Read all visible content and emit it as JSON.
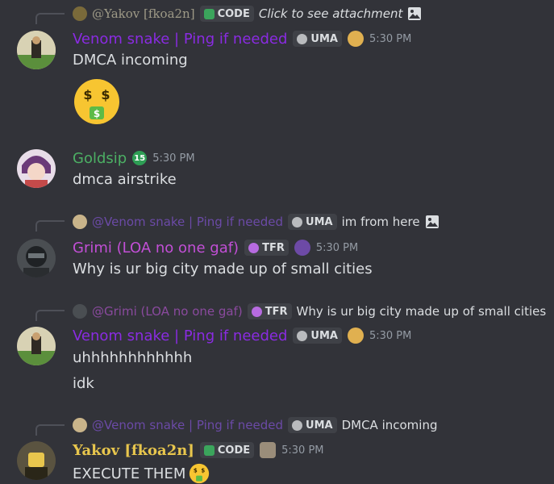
{
  "messages": [
    {
      "reply": {
        "name": "@Yakov [fkoa2n]",
        "tag": "CODE",
        "text": "Click to see attachment",
        "icon": "image-icon"
      },
      "author": "Venom snake | Ping if needed",
      "tag": "UMA",
      "time": "5:30 PM",
      "lines": [
        "DMCA incoming"
      ],
      "emoji": "money-mouth-face-emoji"
    },
    {
      "author": "Goldsip",
      "badge": "15",
      "time": "5:30 PM",
      "lines": [
        "dmca airstrike"
      ]
    },
    {
      "reply": {
        "name": "@Venom snake | Ping if needed",
        "tag": "UMA",
        "text": "im from here",
        "icon": "image-icon"
      },
      "author": "Grimi (LOA no one gaf)",
      "tag": "TFR",
      "time": "5:30 PM",
      "lines": [
        "Why is ur big city made up of small cities"
      ]
    },
    {
      "reply": {
        "name": "@Grimi (LOA no one gaf)",
        "tag": "TFR",
        "text": "Why is ur big city made up of small cities"
      },
      "author": "Venom snake | Ping if needed",
      "tag": "UMA",
      "time": "5:30 PM",
      "lines": [
        "uhhhhhhhhhhhh",
        "idk"
      ]
    },
    {
      "reply": {
        "name": "@Venom snake | Ping if needed",
        "tag": "UMA",
        "text": "DMCA incoming"
      },
      "author": "Yakov [fkoa2n]",
      "tag": "CODE",
      "time": "5:30 PM",
      "lines": [
        "EXECUTE THEM"
      ]
    }
  ],
  "colors": {
    "background": "#323339",
    "venom": "#8a2be2",
    "goldsip": "#4caf64",
    "grimi": "#c24fd6",
    "yakov": "#e8c64d"
  }
}
